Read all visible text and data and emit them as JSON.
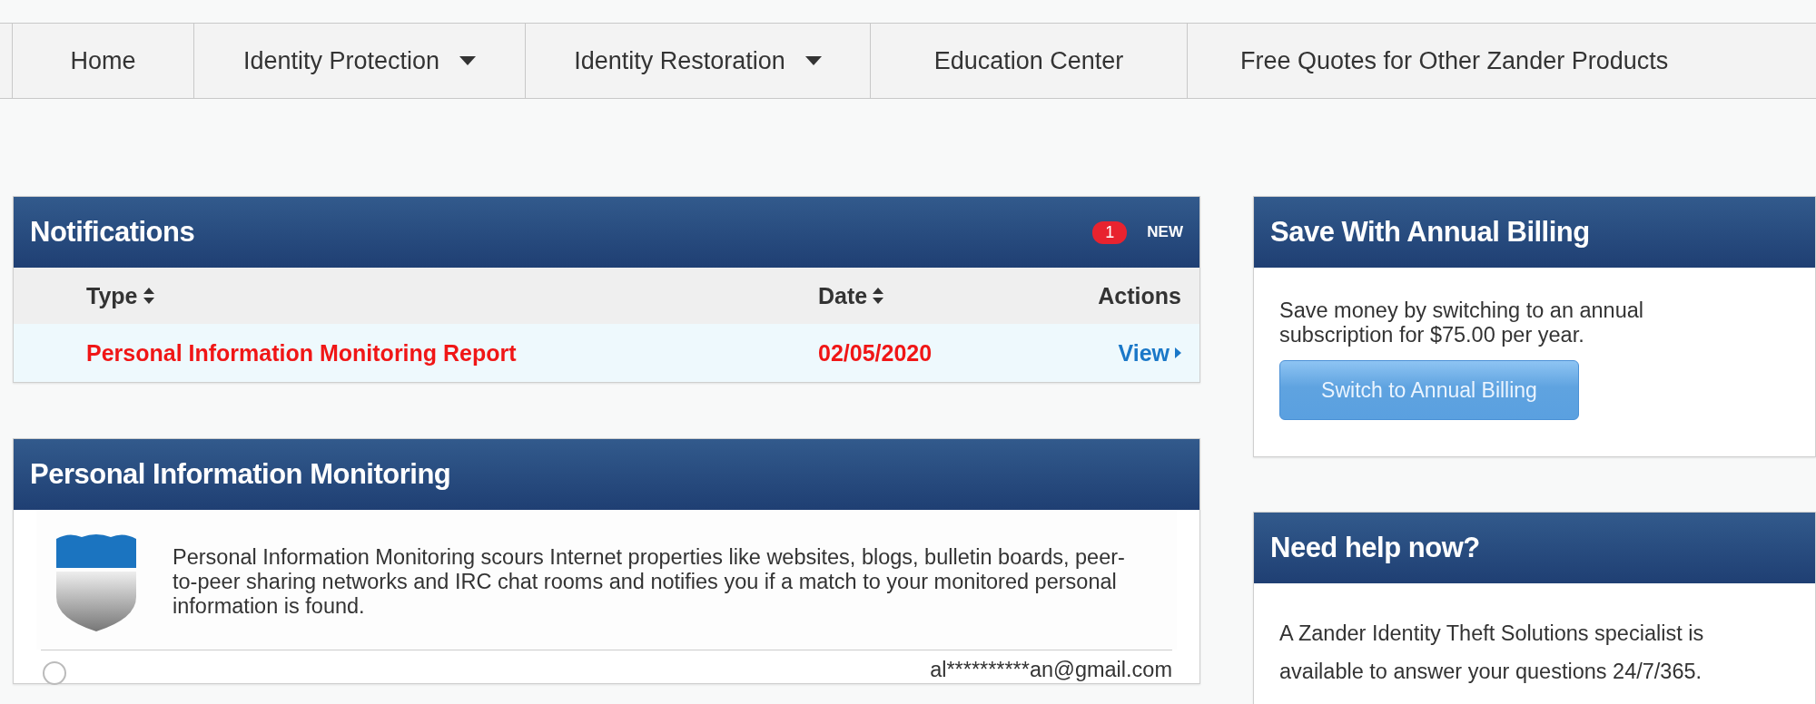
{
  "nav": {
    "items": [
      {
        "label": "Home",
        "dropdown": false
      },
      {
        "label": "Identity Protection",
        "dropdown": true
      },
      {
        "label": "Identity Restoration",
        "dropdown": true
      },
      {
        "label": "Education Center",
        "dropdown": false
      },
      {
        "label": "Free Quotes for Other Zander Products",
        "dropdown": false
      }
    ]
  },
  "notifications": {
    "title": "Notifications",
    "badge": "1",
    "badge_label": "NEW",
    "columns": [
      {
        "label": "Type",
        "sortable": true
      },
      {
        "label": "Date",
        "sortable": true
      },
      {
        "label": "Actions",
        "sortable": false
      }
    ],
    "rows": [
      {
        "type": "Personal Information Monitoring Report",
        "date": "02/05/2020",
        "action": "View",
        "unread": true
      }
    ]
  },
  "monitoring": {
    "title": "Personal Information Monitoring",
    "description": "Personal Information Monitoring scours Internet properties like websites, blogs, bulletin boards, peer-to-peer sharing networks and IRC chat rooms and notifies you if a match to your monitored personal information is found.",
    "entries": [
      {
        "value": "al**********an@gmail.com",
        "selected": false
      }
    ]
  },
  "billing": {
    "title": "Save With Annual Billing",
    "text": "Save money by switching to an annual subscription for $75.00 per year.",
    "button": "Switch to Annual Billing"
  },
  "help": {
    "title": "Need help now?",
    "text": "A Zander Identity Theft Solutions specialist is available to answer your questions 24/7/365."
  }
}
